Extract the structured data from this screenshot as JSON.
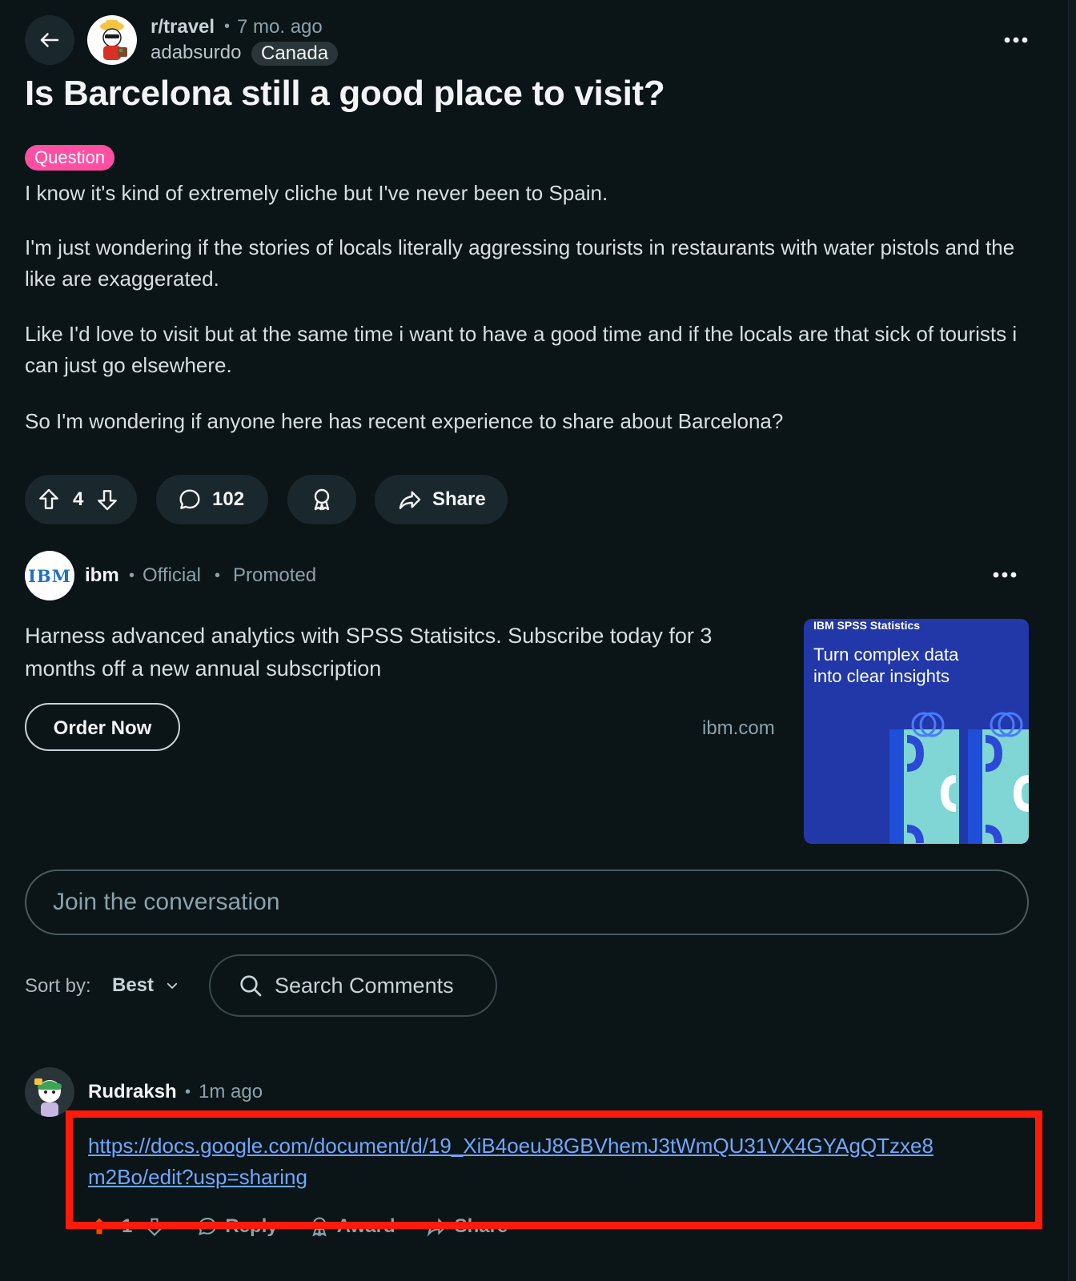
{
  "header": {
    "subreddit": "r/travel",
    "separator": "•",
    "time_ago": "7 mo. ago",
    "author": "adabsurdo",
    "author_flair": "Canada"
  },
  "post": {
    "title": "Is Barcelona still a good place to visit?",
    "flair": "Question",
    "paragraphs": [
      "I know it's kind of extremely cliche but I've never been to Spain.",
      "I'm just wondering if the stories of locals literally aggressing tourists in restaurants with water pistols and the like are exaggerated.",
      "Like I'd love to visit but at the same time i want to have a good time and if the locals are that sick of tourists i can just go elsewhere.",
      "So I'm wondering if anyone here has recent experience to share about Barcelona?"
    ],
    "actions": {
      "votes": "4",
      "comments": "102",
      "share_label": "Share"
    }
  },
  "ad": {
    "logo_text": "IBM",
    "advertiser": "ibm",
    "official": "Official",
    "promoted": "Promoted",
    "body": "Harness advanced analytics with SPSS Statisitcs. Subscribe today for 3 months off a new annual subscription",
    "cta": "Order Now",
    "domain": "ibm.com",
    "image": {
      "brand": "IBM SPSS Statistics",
      "headline_line1": "Turn complex data",
      "headline_line2": "into clear insights",
      "bg_color": "#2238a8",
      "accent_color": "#7fd6d4"
    }
  },
  "comments_bar": {
    "join_placeholder": "Join the conversation",
    "sort_label": "Sort by:",
    "sort_value": "Best",
    "search_placeholder": "Search Comments"
  },
  "comment": {
    "author": "Rudraksh",
    "time_ago": "1m ago",
    "link_line1": "https://docs.google.com/document/d/19_XiB4oeuJ8GBVhemJ3tWmQU31VX4GYAgQTzxe8",
    "link_line2": "m2Bo/edit?usp=sharing",
    "votes": "1",
    "reply_label": "Reply",
    "award_label": "Award",
    "share_label": "Share"
  },
  "colors": {
    "background": "#0b1416",
    "pill": "#1a282d",
    "flair": "#ff4fa3",
    "link": "#6ea8ff",
    "highlight_box": "#ff1a0a"
  }
}
